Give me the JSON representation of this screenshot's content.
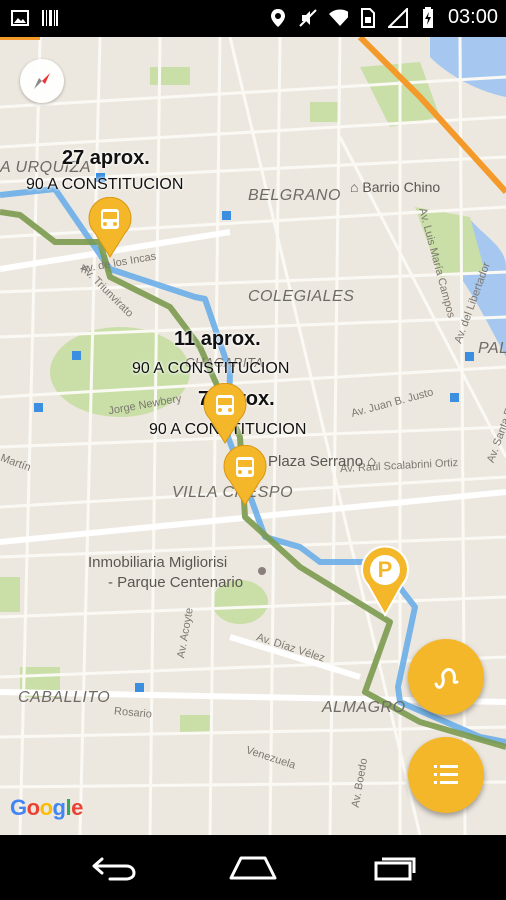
{
  "status_bar": {
    "time": "03:00",
    "left_icons": [
      "image-icon",
      "barcode-icon"
    ],
    "right_icons": [
      "location-pin-icon",
      "mute-icon",
      "wifi-icon",
      "sim-icon",
      "signal-icon",
      "battery-charging-icon"
    ]
  },
  "map": {
    "neighborhoods": {
      "urquiza": "A URQUIZA",
      "belgrano": "BELGRANO",
      "colegiales": "COLEGIALES",
      "chacarita": "CHACARITA",
      "villa_crespo": "VILLA CRESPO",
      "caballito": "CABALLITO",
      "almagro": "ALMAGRO",
      "palermo": "PAL"
    },
    "places": {
      "barrio_chino": "Barrio Chino",
      "plaza_serrano": "Plaza Serrano",
      "inmobiliaria_1": "Inmobiliaria Migliorisi",
      "inmobiliaria_2": "- Parque Centenario"
    },
    "streets": {
      "los_incas": "Av. de los Incas",
      "triunvirato": "Av. Triunvirato",
      "newbery": "Jorge Newbery",
      "scalabrini": "Av. Raúl Scalabrini Ortiz",
      "diaz_velez": "Av. Díaz Vélez",
      "acoyte": "Av. Acoyte",
      "rosario": "Rosario",
      "venezuela": "Venezuela",
      "boedo": "Av. Boedo",
      "libertador": "Av. del Libertador",
      "luis_maria_campos": "Av. Luis María Campos",
      "santa_fe": "Av. Santa Fe",
      "justo": "Av. Juan B. Justo",
      "martin": "Martín"
    },
    "bus_arrivals": [
      {
        "eta": "27 aprox.",
        "line": "90 A CONSTITUCION"
      },
      {
        "eta": "11 aprox.",
        "line": "90 A CONSTITUCION"
      },
      {
        "eta": "7 aprox.",
        "line": "90 A CONSTITUCION"
      }
    ],
    "parking_marker": "P",
    "attribution": {
      "g1": "G",
      "o1": "o",
      "o2": "o",
      "g2": "g",
      "l": "l",
      "e": "e"
    }
  },
  "colors": {
    "marker": "#f4b72a",
    "route_blue": "#6aaee8",
    "route_green": "#7a9a4e",
    "fab": "#f4b72a"
  },
  "controls": {
    "compass": "compass-icon",
    "route_fab": "route-icon",
    "list_fab": "list-icon"
  }
}
